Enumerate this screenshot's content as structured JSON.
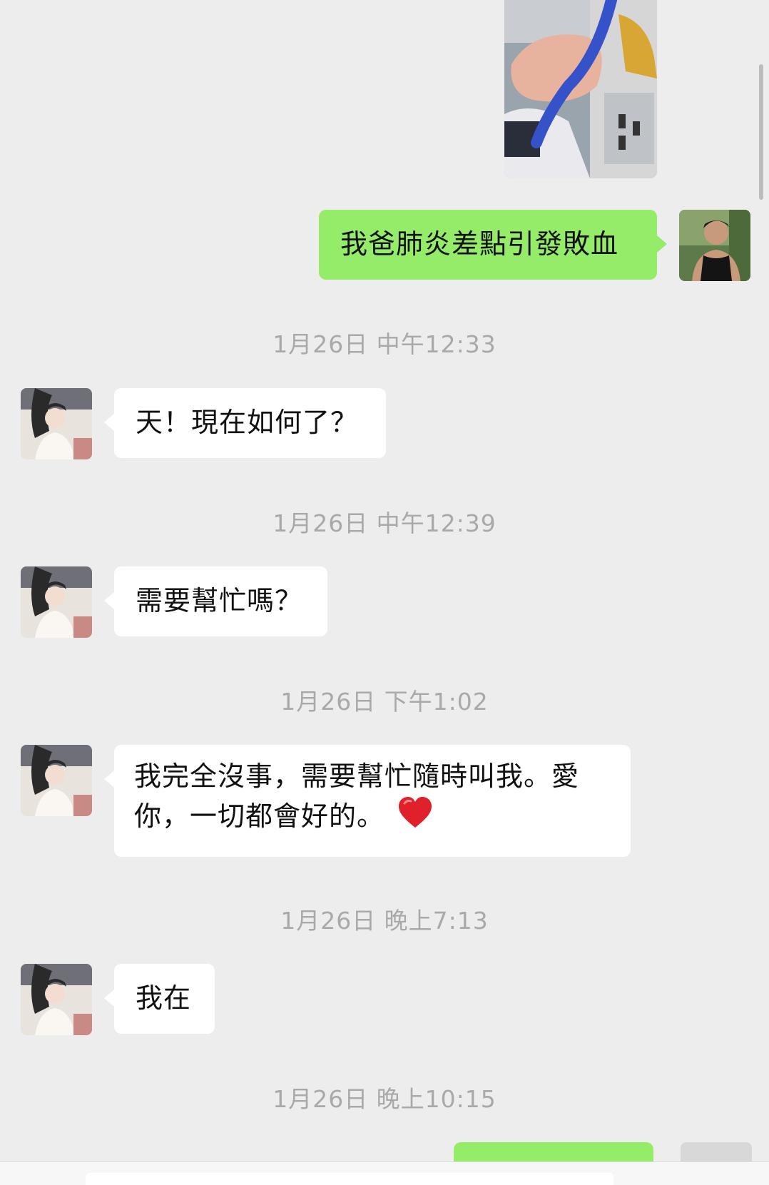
{
  "messages": [
    {
      "type": "image",
      "side": "out",
      "subject": "hospital-bed-photo"
    },
    {
      "type": "text",
      "side": "out",
      "text": "我爸肺炎差點引發敗血"
    },
    {
      "type": "timestamp",
      "text": "1月26日 中午12:33"
    },
    {
      "type": "text",
      "side": "in",
      "text": "天！現在如何了？"
    },
    {
      "type": "timestamp",
      "text": "1月26日 中午12:39"
    },
    {
      "type": "text",
      "side": "in",
      "text": "需要幫忙嗎？"
    },
    {
      "type": "timestamp",
      "text": "1月26日 下午1:02"
    },
    {
      "type": "text",
      "side": "in",
      "line1": "我完全沒事，需要幫忙隨時叫我。愛",
      "line2": "你，一切都會好的。",
      "emoji": "heart-icon"
    },
    {
      "type": "timestamp",
      "text": "1月26日 晚上7:13"
    },
    {
      "type": "text",
      "side": "in",
      "text": "我在"
    },
    {
      "type": "timestamp",
      "text": "1月26日 晚上10:15"
    }
  ],
  "colors": {
    "background": "#ededed",
    "outgoing_bubble": "#95ec69",
    "incoming_bubble": "#ffffff",
    "timestamp": "#a9a9a9",
    "heart": "#e0202a"
  }
}
